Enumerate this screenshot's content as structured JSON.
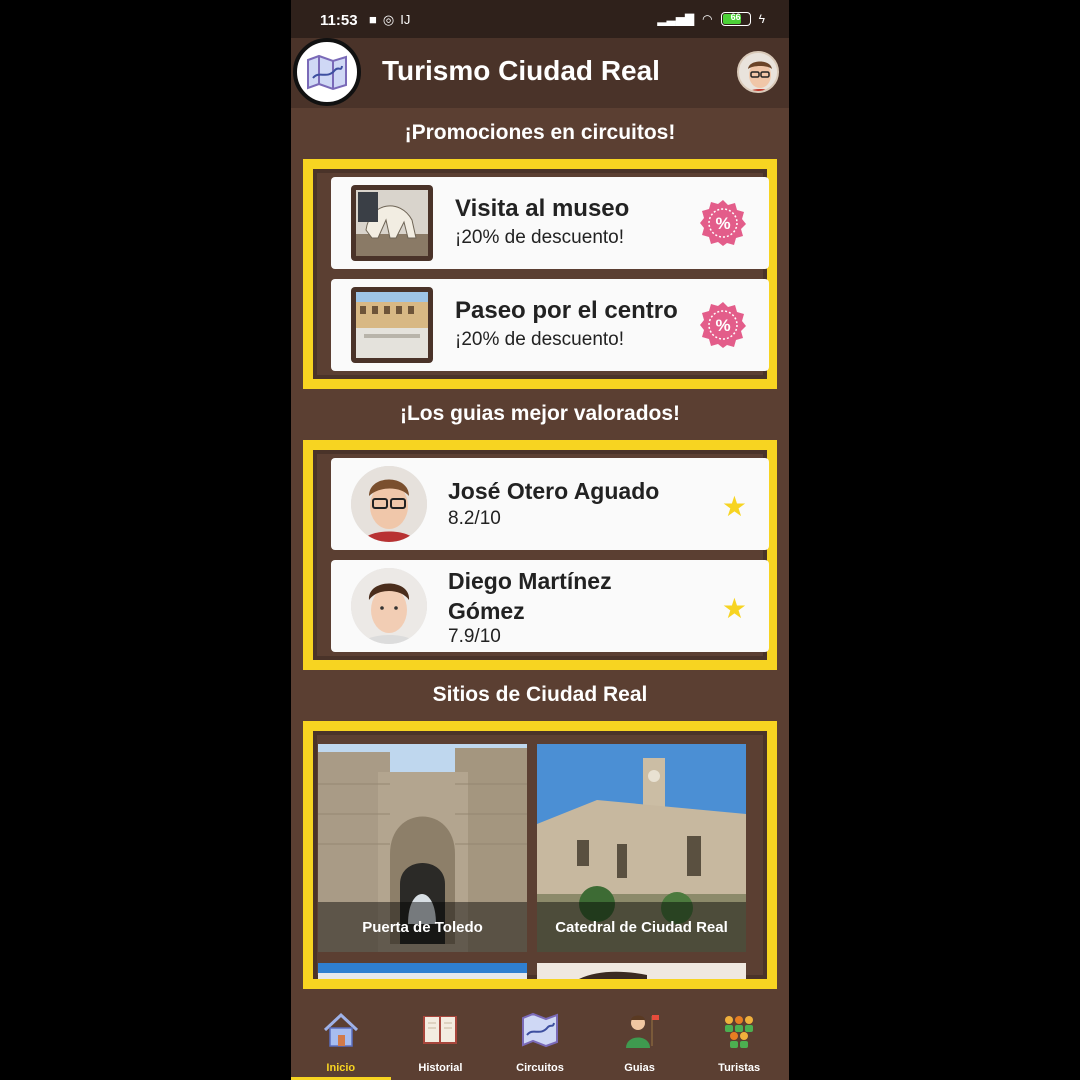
{
  "status_bar": {
    "time": "11:53",
    "battery": "66"
  },
  "app": {
    "title": "Turismo Ciudad Real"
  },
  "sections": {
    "promotions_title": "¡Promociones en circuitos!",
    "guides_title": "¡Los guias mejor valorados!",
    "sites_title": "Sitios de Ciudad Real"
  },
  "promotions": [
    {
      "title": "Visita al museo",
      "subtitle": "¡20% de descuento!"
    },
    {
      "title": "Paseo por el centro",
      "subtitle": "¡20% de descuento!"
    }
  ],
  "guides": [
    {
      "name": "José Otero Aguado",
      "score": "8.2/10"
    },
    {
      "name": "Diego Martínez Gómez",
      "score": "7.9/10"
    }
  ],
  "sites": [
    {
      "label": "Puerta de Toledo"
    },
    {
      "label": "Catedral de Ciudad Real"
    }
  ],
  "nav": [
    {
      "label": "Inicio",
      "active": true,
      "icon": "home-icon"
    },
    {
      "label": "Historial",
      "icon": "book-icon"
    },
    {
      "label": "Circuitos",
      "icon": "map-icon"
    },
    {
      "label": "Guias",
      "icon": "guide-icon"
    },
    {
      "label": "Turistas",
      "icon": "group-icon"
    }
  ],
  "colors": {
    "accent": "#f7d421",
    "background": "#5b3f32",
    "header": "#4a3329"
  }
}
